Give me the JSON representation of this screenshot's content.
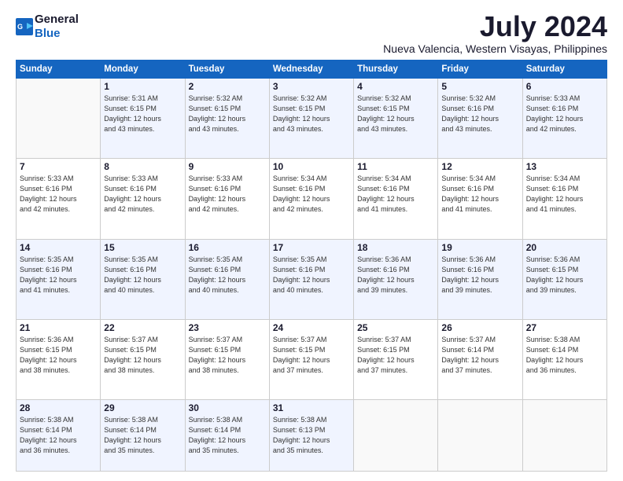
{
  "logo": {
    "line1": "General",
    "line2": "Blue"
  },
  "title": "July 2024",
  "location": "Nueva Valencia, Western Visayas, Philippines",
  "days_header": [
    "Sunday",
    "Monday",
    "Tuesday",
    "Wednesday",
    "Thursday",
    "Friday",
    "Saturday"
  ],
  "weeks": [
    [
      {
        "day": "",
        "info": ""
      },
      {
        "day": "1",
        "info": "Sunrise: 5:31 AM\nSunset: 6:15 PM\nDaylight: 12 hours\nand 43 minutes."
      },
      {
        "day": "2",
        "info": "Sunrise: 5:32 AM\nSunset: 6:15 PM\nDaylight: 12 hours\nand 43 minutes."
      },
      {
        "day": "3",
        "info": "Sunrise: 5:32 AM\nSunset: 6:15 PM\nDaylight: 12 hours\nand 43 minutes."
      },
      {
        "day": "4",
        "info": "Sunrise: 5:32 AM\nSunset: 6:15 PM\nDaylight: 12 hours\nand 43 minutes."
      },
      {
        "day": "5",
        "info": "Sunrise: 5:32 AM\nSunset: 6:16 PM\nDaylight: 12 hours\nand 43 minutes."
      },
      {
        "day": "6",
        "info": "Sunrise: 5:33 AM\nSunset: 6:16 PM\nDaylight: 12 hours\nand 42 minutes."
      }
    ],
    [
      {
        "day": "7",
        "info": "Sunrise: 5:33 AM\nSunset: 6:16 PM\nDaylight: 12 hours\nand 42 minutes."
      },
      {
        "day": "8",
        "info": "Sunrise: 5:33 AM\nSunset: 6:16 PM\nDaylight: 12 hours\nand 42 minutes."
      },
      {
        "day": "9",
        "info": "Sunrise: 5:33 AM\nSunset: 6:16 PM\nDaylight: 12 hours\nand 42 minutes."
      },
      {
        "day": "10",
        "info": "Sunrise: 5:34 AM\nSunset: 6:16 PM\nDaylight: 12 hours\nand 42 minutes."
      },
      {
        "day": "11",
        "info": "Sunrise: 5:34 AM\nSunset: 6:16 PM\nDaylight: 12 hours\nand 41 minutes."
      },
      {
        "day": "12",
        "info": "Sunrise: 5:34 AM\nSunset: 6:16 PM\nDaylight: 12 hours\nand 41 minutes."
      },
      {
        "day": "13",
        "info": "Sunrise: 5:34 AM\nSunset: 6:16 PM\nDaylight: 12 hours\nand 41 minutes."
      }
    ],
    [
      {
        "day": "14",
        "info": "Sunrise: 5:35 AM\nSunset: 6:16 PM\nDaylight: 12 hours\nand 41 minutes."
      },
      {
        "day": "15",
        "info": "Sunrise: 5:35 AM\nSunset: 6:16 PM\nDaylight: 12 hours\nand 40 minutes."
      },
      {
        "day": "16",
        "info": "Sunrise: 5:35 AM\nSunset: 6:16 PM\nDaylight: 12 hours\nand 40 minutes."
      },
      {
        "day": "17",
        "info": "Sunrise: 5:35 AM\nSunset: 6:16 PM\nDaylight: 12 hours\nand 40 minutes."
      },
      {
        "day": "18",
        "info": "Sunrise: 5:36 AM\nSunset: 6:16 PM\nDaylight: 12 hours\nand 39 minutes."
      },
      {
        "day": "19",
        "info": "Sunrise: 5:36 AM\nSunset: 6:16 PM\nDaylight: 12 hours\nand 39 minutes."
      },
      {
        "day": "20",
        "info": "Sunrise: 5:36 AM\nSunset: 6:15 PM\nDaylight: 12 hours\nand 39 minutes."
      }
    ],
    [
      {
        "day": "21",
        "info": "Sunrise: 5:36 AM\nSunset: 6:15 PM\nDaylight: 12 hours\nand 38 minutes."
      },
      {
        "day": "22",
        "info": "Sunrise: 5:37 AM\nSunset: 6:15 PM\nDaylight: 12 hours\nand 38 minutes."
      },
      {
        "day": "23",
        "info": "Sunrise: 5:37 AM\nSunset: 6:15 PM\nDaylight: 12 hours\nand 38 minutes."
      },
      {
        "day": "24",
        "info": "Sunrise: 5:37 AM\nSunset: 6:15 PM\nDaylight: 12 hours\nand 37 minutes."
      },
      {
        "day": "25",
        "info": "Sunrise: 5:37 AM\nSunset: 6:15 PM\nDaylight: 12 hours\nand 37 minutes."
      },
      {
        "day": "26",
        "info": "Sunrise: 5:37 AM\nSunset: 6:14 PM\nDaylight: 12 hours\nand 37 minutes."
      },
      {
        "day": "27",
        "info": "Sunrise: 5:38 AM\nSunset: 6:14 PM\nDaylight: 12 hours\nand 36 minutes."
      }
    ],
    [
      {
        "day": "28",
        "info": "Sunrise: 5:38 AM\nSunset: 6:14 PM\nDaylight: 12 hours\nand 36 minutes."
      },
      {
        "day": "29",
        "info": "Sunrise: 5:38 AM\nSunset: 6:14 PM\nDaylight: 12 hours\nand 35 minutes."
      },
      {
        "day": "30",
        "info": "Sunrise: 5:38 AM\nSunset: 6:14 PM\nDaylight: 12 hours\nand 35 minutes."
      },
      {
        "day": "31",
        "info": "Sunrise: 5:38 AM\nSunset: 6:13 PM\nDaylight: 12 hours\nand 35 minutes."
      },
      {
        "day": "",
        "info": ""
      },
      {
        "day": "",
        "info": ""
      },
      {
        "day": "",
        "info": ""
      }
    ]
  ]
}
